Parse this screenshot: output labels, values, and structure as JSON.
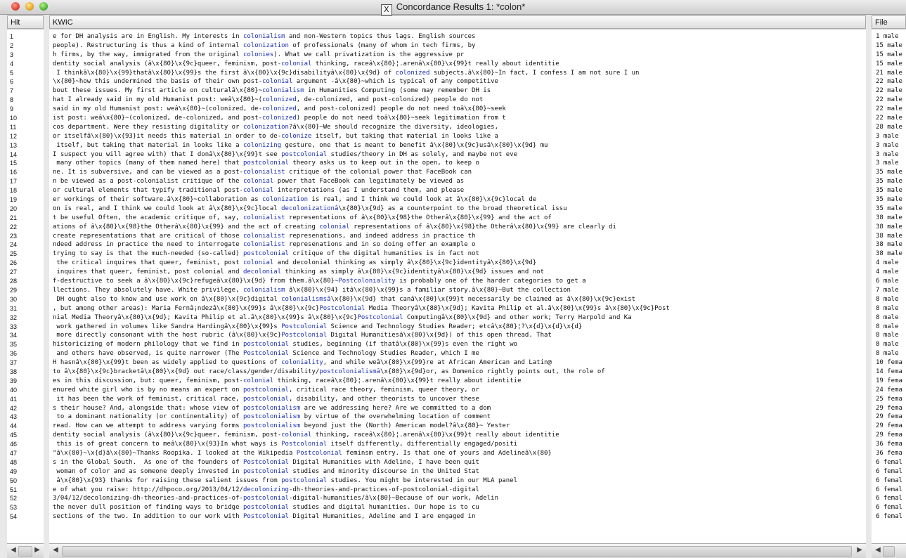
{
  "window": {
    "title": "Concordance Results 1: *colon*",
    "icon_glyph": "X"
  },
  "columns": {
    "hit": "Hit",
    "kwic": "KWIC",
    "file": "File"
  },
  "rows": [
    {
      "hit": "1",
      "pre": "e for DH analysis are in English. My interests in ",
      "kw": "colonialism",
      "post": " and non-Western topics thus lags. English sources",
      "file": "1 male"
    },
    {
      "hit": "2",
      "pre": "people). Restructuring is thus a kind of internal ",
      "kw": "colonization",
      "post": " of professionals (many of whom in tech firms, by",
      "file": "15 male"
    },
    {
      "hit": "3",
      "pre": "h firms, by the way, immigrated from the original ",
      "kw": "colonies",
      "post": "). What we call privatization is the aggressive pr",
      "file": "15 male"
    },
    {
      "hit": "4",
      "pre": "dentity social analysis (â\\x{80}\\x{9c}queer, feminism, post-",
      "kw": "colonial",
      "post": " thinking, raceâ\\x{80}¦.arenâ\\x{80}\\x{99}t really about identitie",
      "file": "15 male"
    },
    {
      "hit": "5",
      "pre": " I thinkâ\\x{80}\\x{99}thatâ\\x{80}\\x{99}s the first â\\x{80}\\x{9c}disabilityâ\\x{80}\\x{9d} of ",
      "kw": "colonized",
      "post": " subjects.â\\x{80}~In fact, I confess I am not sure I un",
      "file": "21 male"
    },
    {
      "hit": "6",
      "pre": "\\x{80}~how this undermined the basis of their own post-",
      "kw": "colonial",
      "post": " argument -â\\x{80}~which is typical of any competitive",
      "file": "22 male"
    },
    {
      "hit": "7",
      "pre": "bout these issues. My first article on culturalâ\\x{80}~",
      "kw": "colonialism",
      "post": " in Humanities Computing (some may remember DH is",
      "file": "22 male"
    },
    {
      "hit": "8",
      "pre": "hat I already said in my old Humanist post: weâ\\x{80}~(",
      "kw": "colonized",
      "post": ", de-colonized, and post-colonized) people do not",
      "file": "22 male"
    },
    {
      "hit": "9",
      "pre": "said in my old Humanist post: weâ\\x{80}~(colonized, de-",
      "kw": "colonized",
      "post": ", and post-colonized) people do not need toâ\\x{80}~seek",
      "file": "22 male"
    },
    {
      "hit": "10",
      "pre": "ist post: weâ\\x{80}~(colonized, de-colonized, and post-",
      "kw": "colonized",
      "post": ") people do not need toâ\\x{80}~seek legitimation from t",
      "file": "22 male"
    },
    {
      "hit": "11",
      "pre": "cos department. Were they resisting digitality or ",
      "kw": "colonization",
      "post": "?â\\x{80}~We should recognize the diversity, ideologies,",
      "file": "28 male"
    },
    {
      "hit": "12",
      "pre": "or itselfâ\\x{80}\\x{93}it needs this material in order to de-",
      "kw": "colonize",
      "post": " itself, but taking that material in looks like a",
      "file": "3 male"
    },
    {
      "hit": "13",
      "pre": " itself, but taking that material in looks like a ",
      "kw": "colonizing",
      "post": " gesture, one that is meant to benefit â\\x{80}\\x{9c}usâ\\x{80}\\x{9d} mu",
      "file": "3 male"
    },
    {
      "hit": "14",
      "pre": "I suspect you will agree with) that I donâ\\x{80}\\x{99}t see ",
      "kw": "postcolonial",
      "post": " studies/theory in DH as solely, and maybe not eve",
      "file": "3 male"
    },
    {
      "hit": "15",
      "pre": " many other topics (many of them named here) that ",
      "kw": "postcolonial",
      "post": " theory asks us to keep out in the open, to keep o",
      "file": "3 male"
    },
    {
      "hit": "16",
      "pre": "ne. It is subversive, and can be viewed as a post-",
      "kw": "colonialist",
      "post": " critique of the colonial power that FaceBook can",
      "file": "35 male"
    },
    {
      "hit": "17",
      "pre": "n be viewed as a post-colonialist critique of the ",
      "kw": "colonial",
      "post": " power that FaceBook can legitimately be viewed as",
      "file": "35 male"
    },
    {
      "hit": "18",
      "pre": "or cultural elements that typify traditional post-",
      "kw": "colonial",
      "post": " interpretations (as I understand them, and please",
      "file": "35 male"
    },
    {
      "hit": "19",
      "pre": "er workings of their software.â\\x{80}~collaboration as ",
      "kw": "colonization",
      "post": " is real, and I think we could look at â\\x{80}\\x{9c}local de",
      "file": "35 male"
    },
    {
      "hit": "20",
      "pre": "on is real, and I think we could look at â\\x{80}\\x{9c}local ",
      "kw": "decolonizationâ",
      "post": "\\x{80}\\x{9d} as a counterpoint to the broad theoretical issu",
      "file": "35 male"
    },
    {
      "hit": "21",
      "pre": "t be useful Often, the academic critique of, say, ",
      "kw": "colonialist",
      "post": " representations of â\\x{80}\\x{98}the Otherâ\\x{80}\\x{99} and the act of",
      "file": "38 male"
    },
    {
      "hit": "22",
      "pre": "ations of â\\x{80}\\x{98}the Otherâ\\x{80}\\x{99} and the act of creating ",
      "kw": "colonial",
      "post": " representations of â\\x{80}\\x{98}the Otherâ\\x{80}\\x{99} are clearly di",
      "file": "38 male"
    },
    {
      "hit": "23",
      "pre": "create representations that are critical of those ",
      "kw": "colonialist",
      "post": " represenations, and indeed address in practice th",
      "file": "38 male"
    },
    {
      "hit": "24",
      "pre": "ndeed address in practice the need to interrogate ",
      "kw": "colonialist",
      "post": " represenations and in so doing offer an example o",
      "file": "38 male"
    },
    {
      "hit": "25",
      "pre": "trying to say is that the much-needed (so-called) ",
      "kw": "postcolonial",
      "post": " critique of the digital humanities is in fact not",
      "file": "38 male"
    },
    {
      "hit": "26",
      "pre": " the critical inquires that queer, feminist, post ",
      "kw": "colonial",
      "post": " and decolonial thinking as simply â\\x{80}\\x{9c}identityâ\\x{80}\\x{9d}",
      "file": "4 male"
    },
    {
      "hit": "27",
      "pre": " inquires that queer, feminist, post colonial and ",
      "kw": "decolonial",
      "post": " thinking as simply â\\x{80}\\x{9c}identityâ\\x{80}\\x{9d} issues and not",
      "file": "4 male"
    },
    {
      "hit": "28",
      "pre": "f-destructive to seek a â\\x{80}\\x{9c}refugeâ\\x{80}\\x{9d} from them.â\\x{80}~",
      "kw": "Postcoloniality",
      "post": " is probably one of the harder categories to get a",
      "file": "6 male"
    },
    {
      "hit": "29",
      "pre": "llections. They absolutely have. White privilege, ",
      "kw": "colonialism",
      "post": " â\\x{80}\\x{94} itâ\\x{80}\\x{99}s a familiar story.â\\x{80}~But the collection",
      "file": "7 male"
    },
    {
      "hit": "30",
      "pre": " DH ought also to know and use work on â\\x{80}\\x{9c}digital ",
      "kw": "colonialismsâ",
      "post": "\\x{80}\\x{9d} that canâ\\x{80}\\x{99}t necessarily be claimed as â\\x{80}\\x{9c}exist",
      "file": "8 male"
    },
    {
      "hit": "31",
      "pre": ", but among other areas): Maria Fernâ¡ndezâ\\x{80}\\x{99}s â\\x{80}\\x{9c}",
      "kw": "Postcolonial",
      "post": " Media Theoryâ\\x{80}\\x{9d}; Kavita Philip et al.â\\x{80}\\x{99}s â\\x{80}\\x{9c}Post",
      "file": "8 male"
    },
    {
      "hit": "32",
      "pre": "nial Media Theoryâ\\x{80}\\x{9d}; Kavita Philip et al.â\\x{80}\\x{99}s â\\x{80}\\x{9c}",
      "kw": "Postcolonial",
      "post": " Computingâ\\x{80}\\x{9d} and other work; Terry Harpold and Ka",
      "file": "8 male"
    },
    {
      "hit": "33",
      "pre": " work gathered in volumes like Sandra Hardingâ\\x{80}\\x{99}s ",
      "kw": "Postcolonial",
      "post": " Science and Technology Studies Reader; etcâ\\x{80}¦?\\x{d}\\x{d}\\x{d}",
      "file": "8 male"
    },
    {
      "hit": "34",
      "pre": " more directly consonant with the host rubric (â\\x{80}\\x{9c}",
      "kw": "Postcolonial",
      "post": " Digital Humanitiesâ\\x{80}\\x{9d}) of this open thread. That",
      "file": "8 male"
    },
    {
      "hit": "35",
      "pre": "historicizing of modern philology that we find in ",
      "kw": "postcolonial",
      "post": " studies, beginning (if thatâ\\x{80}\\x{99}s even the right wo",
      "file": "8 male"
    },
    {
      "hit": "36",
      "pre": " and others have observed, is quite narrower (The ",
      "kw": "Postcolonial",
      "post": " Science and Technology Studies Reader, which I me",
      "file": "8 male"
    },
    {
      "hit": "37",
      "pre": "H hasnâ\\x{80}\\x{99}t been as widely applied to questions of ",
      "kw": "coloniality",
      "post": ", and while weâ\\x{80}\\x{99}re at African American and Latin@",
      "file": "10 fema"
    },
    {
      "hit": "38",
      "pre": "to â\\x{80}\\x{9c}bracketâ\\x{80}\\x{9d} out race/class/gender/disability/",
      "kw": "postcolonialismâ",
      "post": "\\x{80}\\x{9d}or, as Domenico rightly points out, the role of",
      "file": "14 fema"
    },
    {
      "hit": "39",
      "pre": "es in this discussion, but: queer, feminism, post-",
      "kw": "colonial",
      "post": " thinking, raceâ\\x{80}¦.arenâ\\x{80}\\x{99}t really about identitie",
      "file": "19 fema"
    },
    {
      "hit": "40",
      "pre": "enured white girl who is by no means an expert on ",
      "kw": "postcolonial",
      "post": ", critical race theory, feminism, queer theory, or",
      "file": "24 fema"
    },
    {
      "hit": "41",
      "pre": " it has been the work of feminist, critical race, ",
      "kw": "postcolonial",
      "post": ", disability, and other theorists to uncover these",
      "file": "25 fema"
    },
    {
      "hit": "42",
      "pre": "s their house? And, alongside that: whose view of ",
      "kw": "postcolonialism",
      "post": " are we addressing here? Are we committed to a dom",
      "file": "29 fema"
    },
    {
      "hit": "43",
      "pre": " to a dominant nationality (or continentality) of ",
      "kw": "postcolonialism",
      "post": " by virtue of the overwhelming location of comment",
      "file": "29 fema"
    },
    {
      "hit": "44",
      "pre": "read. How can we attempt to address varying forms ",
      "kw": "postcolonialism",
      "post": " beyond just the (North) American model?â\\x{80}~ Yester",
      "file": "29 fema"
    },
    {
      "hit": "45",
      "pre": "dentity social analysis (â\\x{80}\\x{9c}queer, feminism, post-",
      "kw": "colonial",
      "post": " thinking, raceâ\\x{80}¦.arenâ\\x{80}\\x{99}t really about identitie",
      "file": "29 fema"
    },
    {
      "hit": "46",
      "pre": " this is of great concern to meâ\\x{80}\\x{93}In what ways is ",
      "kw": "Postcolonial",
      "post": " itself differently, differentially engaged/positi",
      "file": "36 fema"
    },
    {
      "hit": "47",
      "pre": "\"â\\x{80}~\\x{d}â\\x{80}~Thanks Roopika. I looked at the Wikipedia ",
      "kw": "Postcolonial",
      "post": " feminsm entry. Is that one of yours and Adelineâ\\x{80}",
      "file": "36 fema"
    },
    {
      "hit": "48",
      "pre": "s in the Global South.  As one of the founders of ",
      "kw": "Postcolonial",
      "post": " Digital Humanities with Adeline, I have been quit",
      "file": "6 femal"
    },
    {
      "hit": "49",
      "pre": " woman of color and as someone deeply invested in ",
      "kw": "postcolonial",
      "post": " studies and minority discourse in the United Stat",
      "file": "6 femal"
    },
    {
      "hit": "50",
      "pre": " â\\x{80}\\x{93} thanks for raising these salient issues from ",
      "kw": "postcolonial",
      "post": " studies. You might be interested in our MLA panel",
      "file": "6 femal"
    },
    {
      "hit": "51",
      "pre": "e of what you raise: http://dhpoco.org/2013/04/12/",
      "kw": "decolonizing",
      "post": "-dh-theories-and-practices-of-postcolonial-digital",
      "file": "6 femal"
    },
    {
      "hit": "52",
      "pre": "3/04/12/decolonizing-dh-theories-and-practices-of-",
      "kw": "postcolonial",
      "post": "-digital-humanities/â\\x{80}~Because of our work, Adelin",
      "file": "6 femal"
    },
    {
      "hit": "53",
      "pre": "the never dull position of finding ways to bridge ",
      "kw": "postcolonial",
      "post": " studies and digital humanities. Our hope is to cu",
      "file": "6 femal"
    },
    {
      "hit": "54",
      "pre": "sections of the two. In addition to our work with ",
      "kw": "Postcolonial",
      "post": " Digital Humanities, Adeline and I are engaged in",
      "file": "6 femal"
    }
  ],
  "icons": [
    "close-light",
    "minimize-light",
    "zoom-light",
    "scroll-left-arrow-icon",
    "scroll-right-arrow-icon"
  ],
  "colors": {
    "keyword": "#1a2fb0"
  }
}
